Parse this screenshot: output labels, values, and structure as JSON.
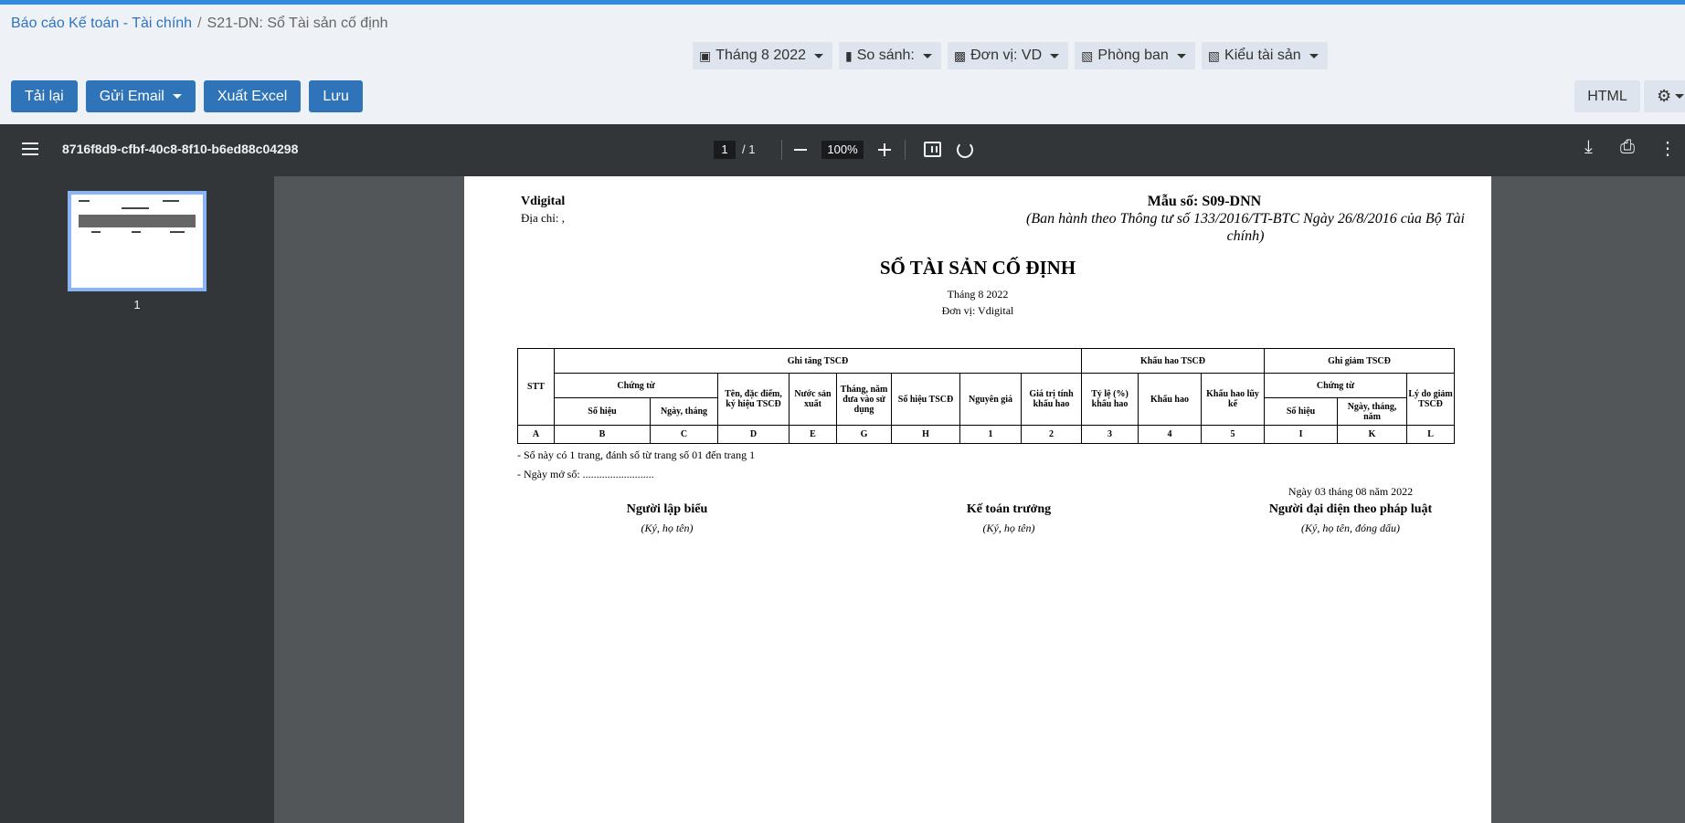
{
  "breadcrumb": {
    "parent": "Báo cáo Kế toán - Tài chính",
    "separator": "/",
    "current": "S21-DN: Sổ Tài sản cố định"
  },
  "filters": {
    "period": "Tháng 8 2022",
    "compare": "So sánh:",
    "unit": "Đơn vị: VD",
    "department": "Phòng ban",
    "asset_type": "Kiểu tài sản"
  },
  "actions": {
    "reload": "Tải lại",
    "send_email": "Gửi Email",
    "export_excel": "Xuất Excel",
    "save": "Lưu",
    "html": "HTML"
  },
  "viewer": {
    "doc_name": "8716f8d9-cfbf-40c8-8f10-b6ed88c04298",
    "current_page": "1",
    "page_total": "/  1",
    "zoom": "100%",
    "thumbnail_label": "1"
  },
  "document": {
    "company": "Vdigital",
    "address": "Địa chỉ: ,",
    "form_no": "Mẫu số: S09-DNN",
    "decree": "(Ban hành theo Thông tư số 133/2016/TT-BTC Ngày 26/8/2016 của Bộ Tài chính)",
    "title": "SỔ TÀI SẢN CỐ ĐỊNH",
    "month": "Tháng 8 2022",
    "unit": "Đơn vị: Vdigital",
    "table": {
      "stt": "STT",
      "group_increase": "Ghi tăng TSCĐ",
      "group_depreciation": "Khấu hao TSCĐ",
      "group_decrease": "Ghi giảm TSCĐ",
      "voucher": "Chứng từ",
      "voucher2": "Chứng từ",
      "name_spec": "Tên, đặc điểm, ký hiệu TSCĐ",
      "country": "Nước sản xuất",
      "month_use": "Tháng, năm đưa vào sử dụng",
      "asset_no": "Số hiệu TSCĐ",
      "original_cost": "Nguyên giá",
      "dep_value": "Giá trị tính khấu hao",
      "rate": "Tỷ lệ (%) khấu hao",
      "depreciation": "Khấu hao",
      "accum_dep": "Khấu hao lũy kế",
      "reason": "Lý do giảm TSCĐ",
      "voucher_no": "Số hiệu",
      "voucher_date": "Ngày, tháng",
      "voucher_no2": "Số hiệu",
      "voucher_date2": "Ngày, tháng, năm",
      "codes": [
        "A",
        "B",
        "C",
        "D",
        "E",
        "G",
        "H",
        "1",
        "2",
        "3",
        "4",
        "5",
        "I",
        "K",
        "L"
      ]
    },
    "note_pages": "- Sổ này có 1 trang, đánh số từ trang số 01 đến trang 1",
    "note_open_date": "- Ngày mở sổ: ..........................",
    "sign_date": "Ngày 03 tháng 08 năm 2022",
    "signers": [
      {
        "title": "Người lập biểu",
        "sub": "(Ký, họ tên)"
      },
      {
        "title": "Kế toán trưởng",
        "sub": "(Ký, họ tên)"
      },
      {
        "title": "Người đại diện theo pháp luật",
        "sub": "(Ký, họ tên, đóng dấu)"
      }
    ]
  }
}
